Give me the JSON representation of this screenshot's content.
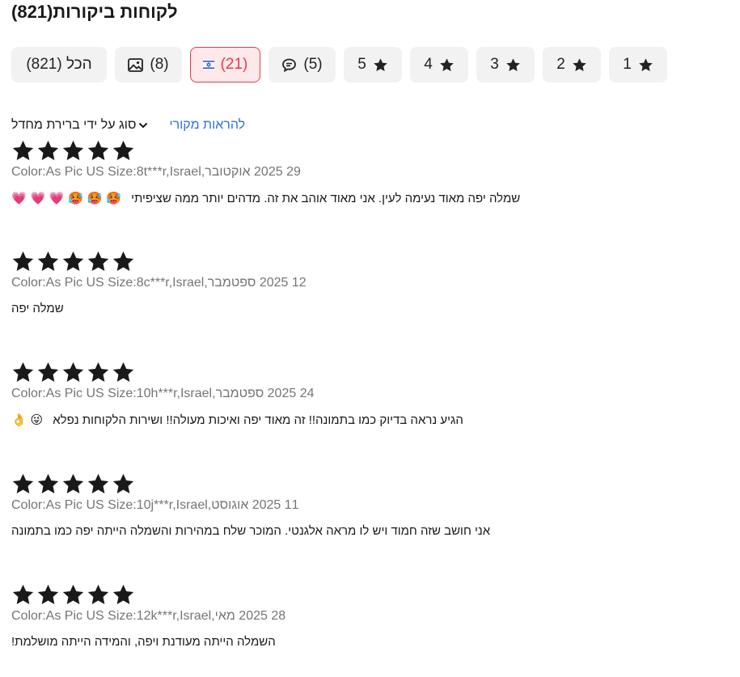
{
  "header": {
    "title": "לקוחות ביקורות(821)"
  },
  "filters": [
    {
      "label": "(821) הכל",
      "icon": "none",
      "active": false
    },
    {
      "label": "(8)",
      "icon": "image-icon",
      "active": false
    },
    {
      "label": "(21)",
      "icon": "israel-flag-icon",
      "active": true
    },
    {
      "label": "(5)",
      "icon": "comment-icon",
      "active": false
    },
    {
      "label": "5",
      "icon": "star-icon",
      "active": false
    },
    {
      "label": "4",
      "icon": "star-icon",
      "active": false
    },
    {
      "label": "3",
      "icon": "star-icon",
      "active": false
    },
    {
      "label": "2",
      "icon": "star-icon",
      "active": false
    },
    {
      "label": "1",
      "icon": "star-icon",
      "active": false
    }
  ],
  "sort": {
    "label": "סוג על ידי ברירת מחדל",
    "show_original": "להראות מקורי"
  },
  "reviews": [
    {
      "rating": 5,
      "variant": "Color:As Pic US Size:8",
      "user": "t***r,Israel,",
      "date": "29 2025 אוקטובר",
      "text": "שמלה יפה מאוד נעימה לעין. אני מאוד אוהב את זה. מדהים יותר ממה שציפיתי",
      "emojis": "🥵 🥵 🥵 💗 💗 💗"
    },
    {
      "rating": 5,
      "variant": "Color:As Pic US Size:8",
      "user": "c***r,Israel,",
      "date": "12 2025 ספטמבר",
      "text": "שמלה יפה",
      "emojis": ""
    },
    {
      "rating": 5,
      "variant": "Color:As Pic US Size:10",
      "user": "h***r,Israel,",
      "date": "24 2025 ספטמבר",
      "text": "הגיע נראה בדיוק כמו בתמונה!! זה מאוד יפה ואיכות מעולה!! ושירות הלקוחות נפלא",
      "emojis": "😜 👌"
    },
    {
      "rating": 5,
      "variant": "Color:As Pic US Size:10",
      "user": "j***r,Israel,",
      "date": "11 2025 אוגוסט",
      "text": "אני חושב שזה חמוד ויש לו מראה אלגנטי. המוכר שלח במהירות והשמלה הייתה יפה כמו בתמונה",
      "emojis": ""
    },
    {
      "rating": 5,
      "variant": "Color:As Pic US Size:12",
      "user": "k***r,Israel,",
      "date": "28 2025 מאי",
      "text": "השמלה הייתה מעודנת ויפה, והמידה הייתה מושלמת!",
      "emojis": ""
    }
  ],
  "colors": {
    "accent": "#e9394b",
    "link": "#2f6fe0",
    "meta": "#757575",
    "star": "#191919"
  }
}
